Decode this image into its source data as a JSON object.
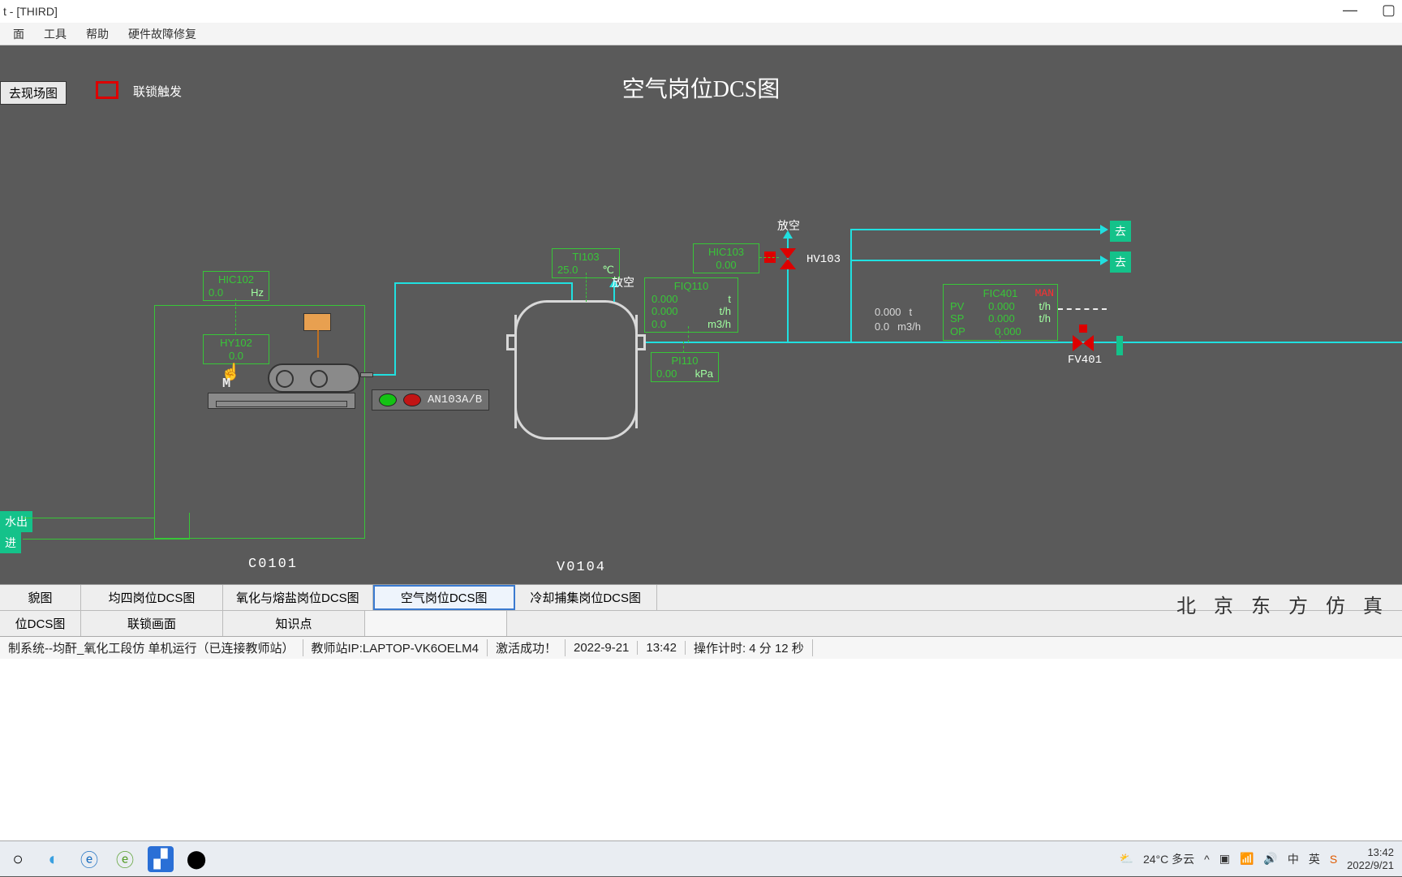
{
  "window": {
    "title": "t - [THIRD]"
  },
  "menu": {
    "m1": "面",
    "m2": "工具",
    "m3": "帮助",
    "m4": "硬件故障修复"
  },
  "header": {
    "go_site": "去现场图",
    "interlock": "联锁触发",
    "title": "空气岗位DCS图"
  },
  "tags": {
    "hic102": {
      "name": "HIC102",
      "val": "0.0",
      "unit": "Hz"
    },
    "hy102": {
      "name": "HY102",
      "val": "0.0"
    },
    "ti103": {
      "name": "TI103",
      "val": "25.0",
      "unit": "℃"
    },
    "hic103": {
      "name": "HIC103",
      "val": "0.00"
    },
    "fiq110": {
      "name": "FIQ110",
      "r1v": "0.000",
      "r1u": "t",
      "r2v": "0.000",
      "r2u": "t/h",
      "r3v": "0.0",
      "r3u": "m3/h"
    },
    "pi110": {
      "name": "PI110",
      "val": "0.00",
      "unit": "kPa"
    },
    "fic401": {
      "name": "FIC401",
      "mode": "MAN",
      "pv_l": "PV",
      "pv_v": "0.000",
      "pv_u": "t/h",
      "sp_l": "SP",
      "sp_v": "0.000",
      "sp_u": "t/h",
      "op_l": "OP",
      "op_v": "0.000"
    },
    "fic_side": {
      "r1v": "0.000",
      "r1u": "t",
      "r2v": "0.0",
      "r2u": "m3/h"
    }
  },
  "labels": {
    "an103": "AN103A/B",
    "c0101": "C0101",
    "v0104": "V0104",
    "fangkong1": "放空",
    "fangkong2": "放空",
    "hv103": "HV103",
    "fv401": "FV401",
    "water_out": "水出",
    "water_in": "进",
    "go1": "去",
    "go2": "去"
  },
  "tabs": {
    "r1": [
      "貌图",
      "均四岗位DCS图",
      "氧化与熔盐岗位DCS图",
      "空气岗位DCS图",
      "冷却捕集岗位DCS图"
    ],
    "r2": [
      "位DCS图",
      "联锁画面",
      "知识点",
      ""
    ],
    "logo": "北 京 东 方 仿 真"
  },
  "status": {
    "s1": "制系统--均酐_氧化工段仿  单机运行（已连接教师站）",
    "s2": "教师站IP:LAPTOP-VK6OELM4",
    "s3": "激活成功！",
    "s4": "2022-9-21",
    "s5": "13:42",
    "s6": "操作计时: 4 分 12 秒"
  },
  "taskbar": {
    "weather": "24°C 多云",
    "time": "13:42",
    "date": "2022/9/21"
  }
}
